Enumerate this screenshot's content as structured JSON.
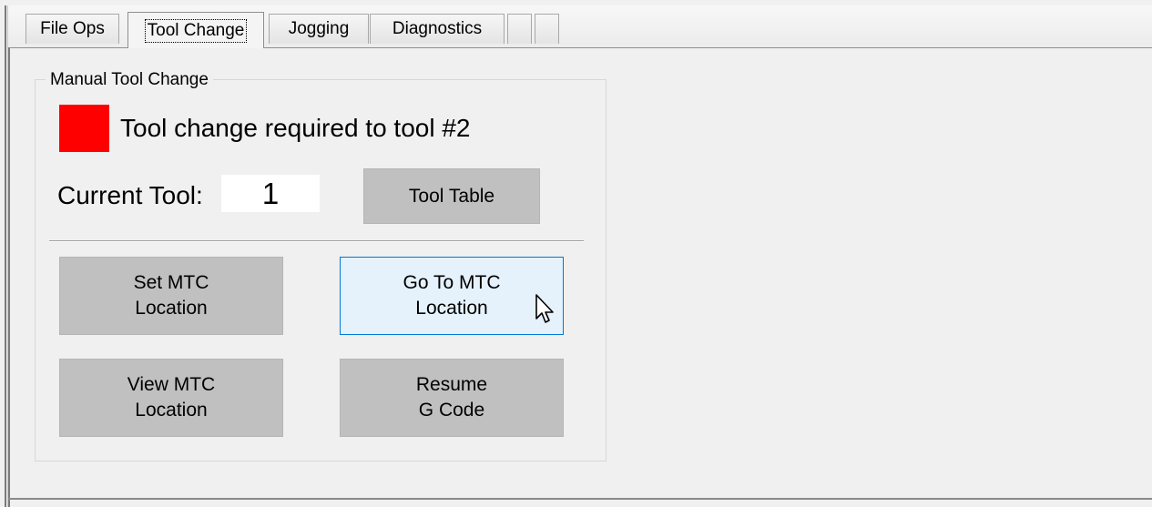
{
  "tabs": [
    {
      "label": "File Ops",
      "active": false
    },
    {
      "label": "Tool Change",
      "active": true
    },
    {
      "label": "Jogging",
      "active": false
    },
    {
      "label": "Diagnostics",
      "active": false
    },
    {
      "label": "",
      "active": false
    },
    {
      "label": "",
      "active": false
    }
  ],
  "manual_tool_change": {
    "group_title": "Manual Tool Change",
    "status_indicator_color": "#ff0000",
    "status_message": "Tool change required to tool #2",
    "current_tool_label": "Current Tool:",
    "current_tool_value": "1",
    "buttons": {
      "tool_table": "Tool Table",
      "set_mtc_location": "Set MTC\nLocation",
      "go_to_mtc_location": "Go To MTC\nLocation",
      "view_mtc_location": "View MTC\nLocation",
      "resume_g_code": "Resume\nG Code"
    }
  },
  "colors": {
    "background": "#f0f0f0",
    "button_face": "#c0c0c0",
    "button_hover_face": "#e5f1fb",
    "button_hover_border": "#0078d7"
  },
  "cursor": "arrow-pointer-icon"
}
